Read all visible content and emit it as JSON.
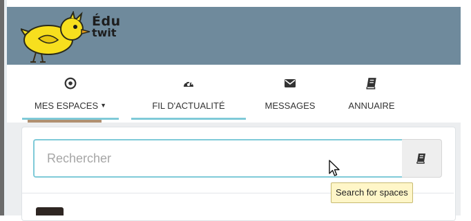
{
  "header": {
    "logo_line1": "Édu",
    "logo_line2": "twit",
    "color": "#6f8a9c"
  },
  "nav": {
    "items": [
      {
        "label": "MES ESPACES",
        "icon": "circle-dot-icon",
        "has_caret": true
      },
      {
        "label": "FIL D'ACTUALITÉ",
        "icon": "dashboard-icon"
      },
      {
        "label": "MESSAGES",
        "icon": "envelope-icon"
      },
      {
        "label": "ANNUAIRE",
        "icon": "book-icon"
      }
    ],
    "active_color": "#7fcad8"
  },
  "spaces_dropdown": {
    "search_placeholder": "Rechercher",
    "search_value": "",
    "search_button_icon": "book-icon",
    "tooltip": "Search for spaces"
  },
  "colors": {
    "accent": "#7fcad8",
    "tooltip_bg": "#fff6c8"
  }
}
